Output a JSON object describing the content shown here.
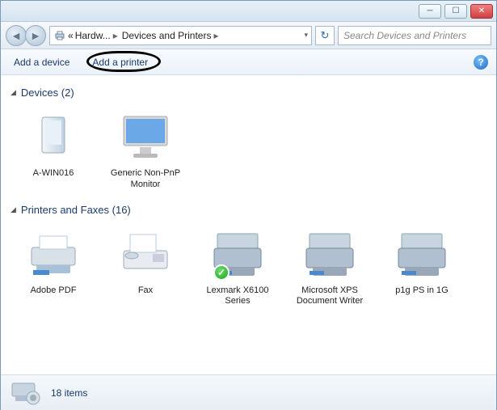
{
  "titlebar": {
    "minimize": "─",
    "maximize": "☐",
    "close": "✕"
  },
  "nav": {
    "back": "◄",
    "forward": "►",
    "breadcrumb": {
      "part1": "Hardw...",
      "part2": "Devices and Printers",
      "dropdown": "▾"
    },
    "refresh": "↻",
    "search_placeholder": "Search Devices and Printers"
  },
  "toolbar": {
    "add_device": "Add a device",
    "add_printer": "Add a printer",
    "help": "?"
  },
  "groups": [
    {
      "title": "Devices (2)",
      "items": [
        {
          "label": "A-WIN016",
          "icon": "computer"
        },
        {
          "label": "Generic Non-PnP Monitor",
          "icon": "monitor"
        }
      ]
    },
    {
      "title": "Printers and Faxes (16)",
      "items": [
        {
          "label": "Adobe PDF",
          "icon": "printer"
        },
        {
          "label": "Fax",
          "icon": "fax"
        },
        {
          "label": "Lexmark X6100 Series",
          "icon": "mfp",
          "default": true
        },
        {
          "label": "Microsoft XPS Document Writer",
          "icon": "mfp"
        },
        {
          "label": "p1g PS in 1G",
          "icon": "mfp"
        }
      ]
    }
  ],
  "status": {
    "count_text": "18 items"
  }
}
